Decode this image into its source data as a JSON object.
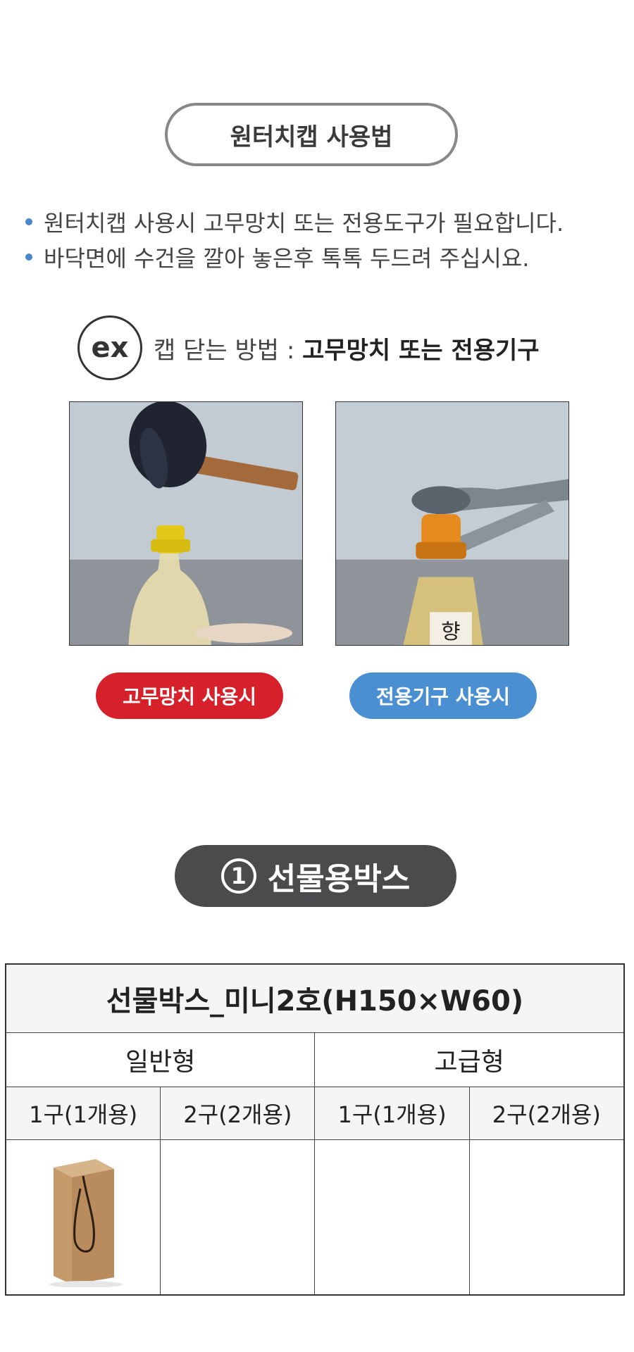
{
  "usage": {
    "title": "원터치캡 사용법",
    "bullets": [
      "원터치캡 사용시  고무망치 또는 전용도구가 필요합니다.",
      "바닥면에 수건을 깔아 놓은후 톡톡 두드려 주십시요."
    ],
    "ex_badge": "ex",
    "ex_prefix": "캡 닫는 방법 : ",
    "ex_method": "고무망치 또는 전용기구",
    "hammer_label": "고무망치 사용시",
    "tool_label": "전용기구 사용시",
    "colors": {
      "hammer_label": "#d6202a",
      "tool_label": "#4a8fd2",
      "bullet": "#4a86c8"
    }
  },
  "giftbox": {
    "number": "1",
    "section_title": "선물용박스",
    "table": {
      "title": "선물박스_미니2호(H150×W60)",
      "groups": [
        "일반형",
        "고급형"
      ],
      "columns": [
        "1구(1개용)",
        "2구(2개용)",
        "1구(1개용)",
        "2구(2개용)"
      ],
      "image_icon": "kraft-gift-box-icon"
    }
  }
}
